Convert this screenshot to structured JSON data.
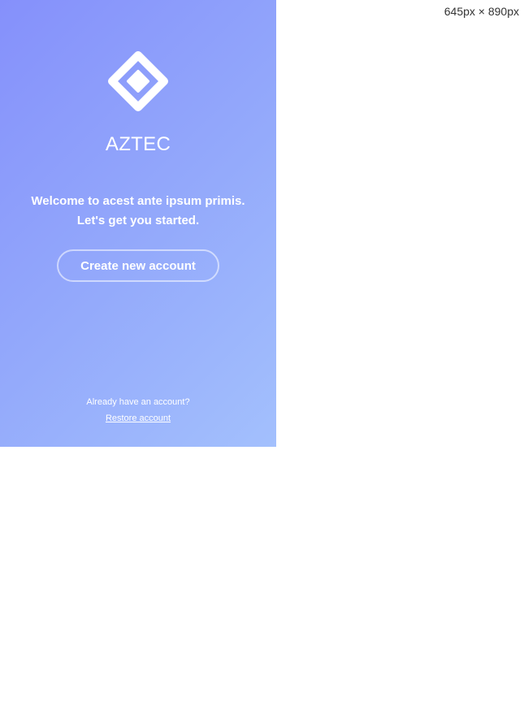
{
  "viewport_label": "645px × 890px",
  "app": {
    "logo_icon": "diamond-logo-icon",
    "brand_name": "AZTEC",
    "welcome_line1": "Welcome to acest ante ipsum primis.",
    "welcome_line2": "Let's get you started.",
    "create_button_label": "Create new account",
    "already_text": "Already have an account?",
    "restore_link_label": "Restore account"
  },
  "colors": {
    "gradient_start": "#8590fb",
    "gradient_end": "#a3c0fd",
    "text": "#ffffff"
  }
}
